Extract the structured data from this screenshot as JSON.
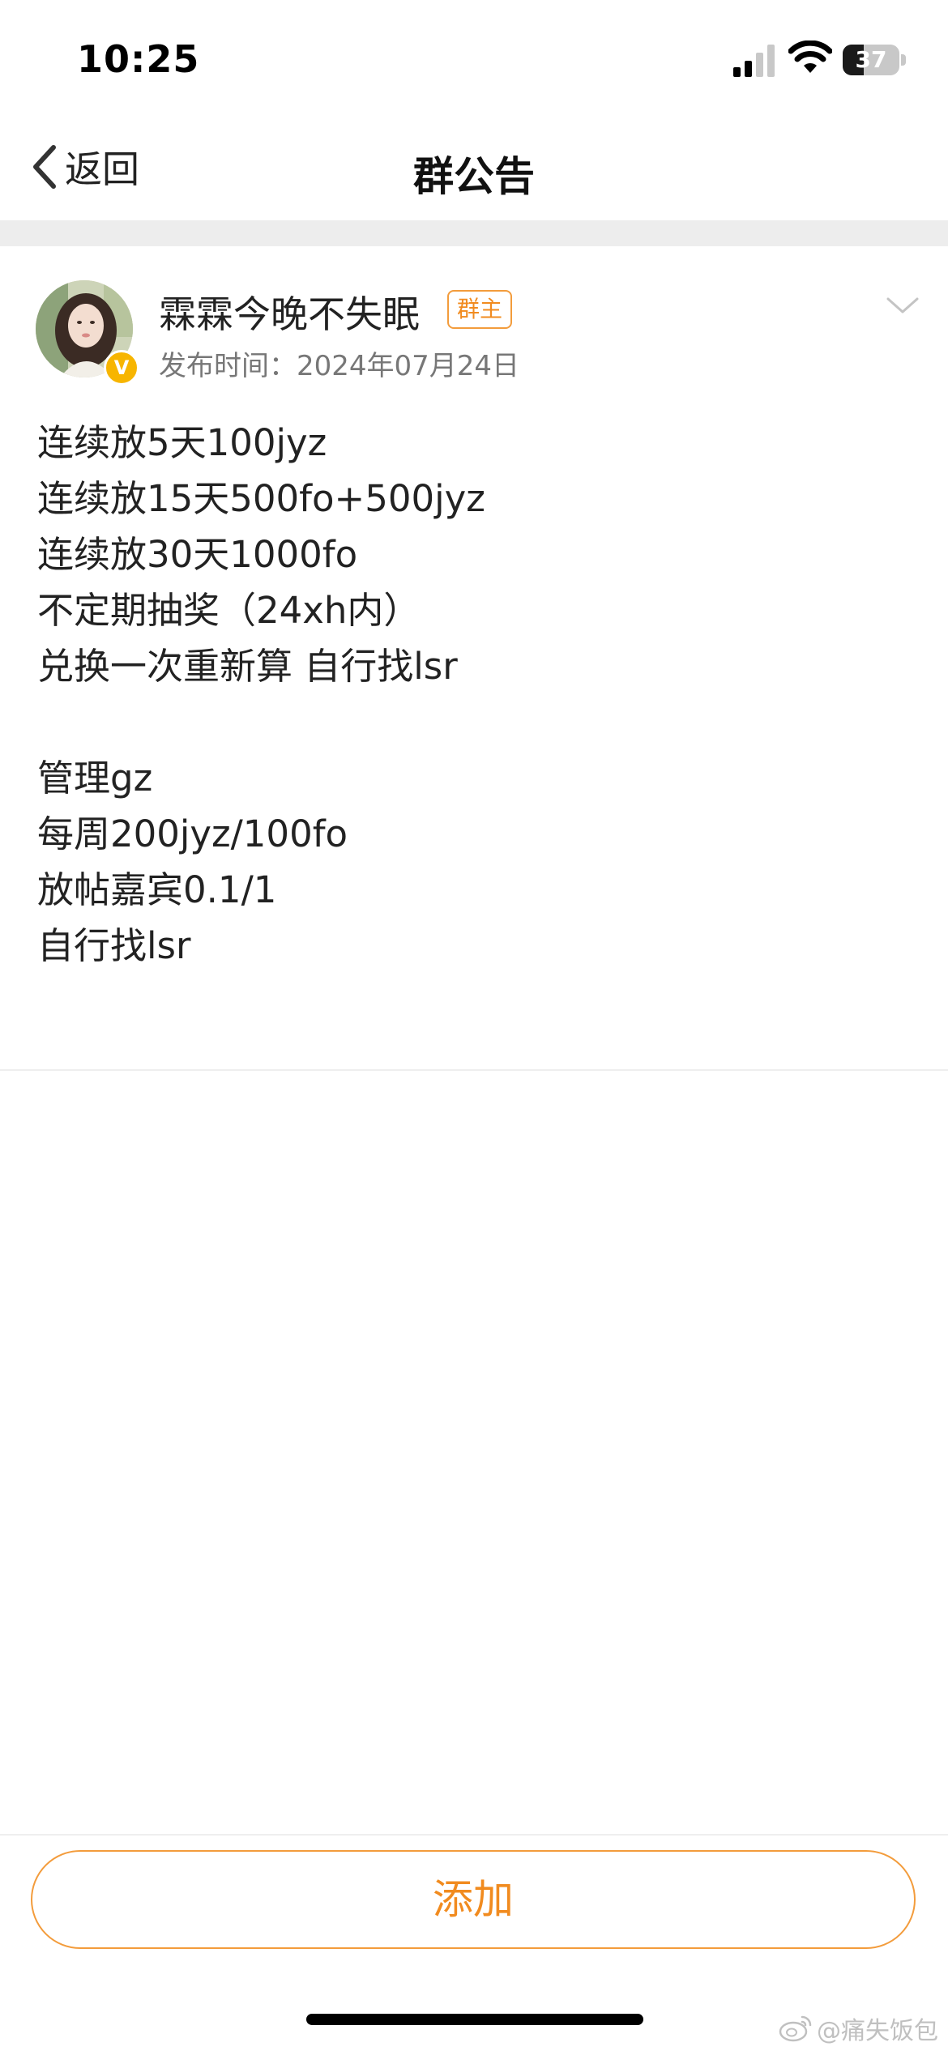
{
  "status_bar": {
    "time": "10:25",
    "battery_level": "37",
    "battery_fraction": 0.37
  },
  "nav": {
    "back_label": "返回",
    "title": "群公告"
  },
  "post": {
    "author_name": "霖霖今晚不失眠",
    "role_badge": "群主",
    "verified_mark": "V",
    "publish_time": "发布时间：2024年07月24日",
    "lines": [
      "连续放5天100jyz",
      "连续放15天500fo+500jyz",
      "连续放30天1000fo",
      "不定期抽奖（24xh内）",
      "兑换一次重新算 自行找lsr",
      "",
      "管理gz",
      "每周200jyz/100fo",
      "放帖嘉宾0.1/1",
      "自行找lsr"
    ]
  },
  "footer": {
    "add_label": "添加"
  },
  "watermark": {
    "text": "@痛失饭包"
  },
  "colors": {
    "accent": "#f18b1f",
    "accent_border": "#f39c3c",
    "verified": "#f7b500",
    "divider": "#ededed",
    "muted_text": "#777777"
  },
  "icons": {
    "back": "chevron-left-icon",
    "expand": "chevron-down-icon",
    "signal": "cellular-signal-icon",
    "wifi": "wifi-icon",
    "battery": "battery-icon",
    "watermark": "weibo-icon"
  }
}
